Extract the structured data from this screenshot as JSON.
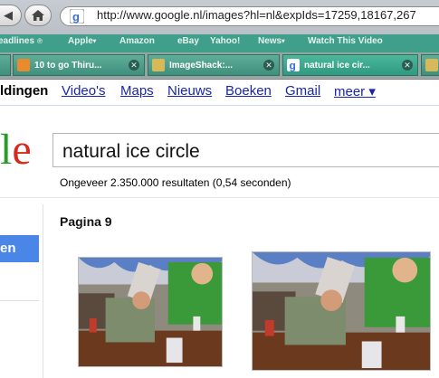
{
  "browser": {
    "url": "http://www.google.nl/images?hl=nl&expIds=17259,18167,267",
    "bookmarks": [
      {
        "label": "eadlines",
        "has_rss": true
      },
      {
        "label": "Apple",
        "has_menu": true
      },
      {
        "label": "Amazon"
      },
      {
        "label": "eBay"
      },
      {
        "label": "Yahoo!"
      },
      {
        "label": "News",
        "has_menu": true
      },
      {
        "label": "Watch This Video"
      }
    ],
    "tabs": [
      {
        "title": "10 to go Thiru...",
        "active": false
      },
      {
        "title": "ImageShack:...",
        "active": false
      },
      {
        "title": "natural ice cir...",
        "active": true
      }
    ],
    "icons": {
      "back": "back-arrow-icon",
      "home": "home-icon",
      "close": "close-icon"
    }
  },
  "google": {
    "nav": {
      "current": "ldingen",
      "links": [
        "Video's",
        "Maps",
        "Nieuws",
        "Boeken",
        "Gmail",
        "meer ▾"
      ]
    },
    "logo_fragment": {
      "l": "l",
      "e": "e"
    },
    "search_query": "natural ice circle",
    "results_count": "Ongeveer 2.350.000 resultaten (0,54 seconden)",
    "left_button": "en",
    "page_label": "Pagina 9",
    "colors": {
      "link": "#1a25ab",
      "accent_blue": "#4a86e8",
      "logo_green": "#2a9a2a",
      "logo_red": "#d62a1e"
    }
  }
}
